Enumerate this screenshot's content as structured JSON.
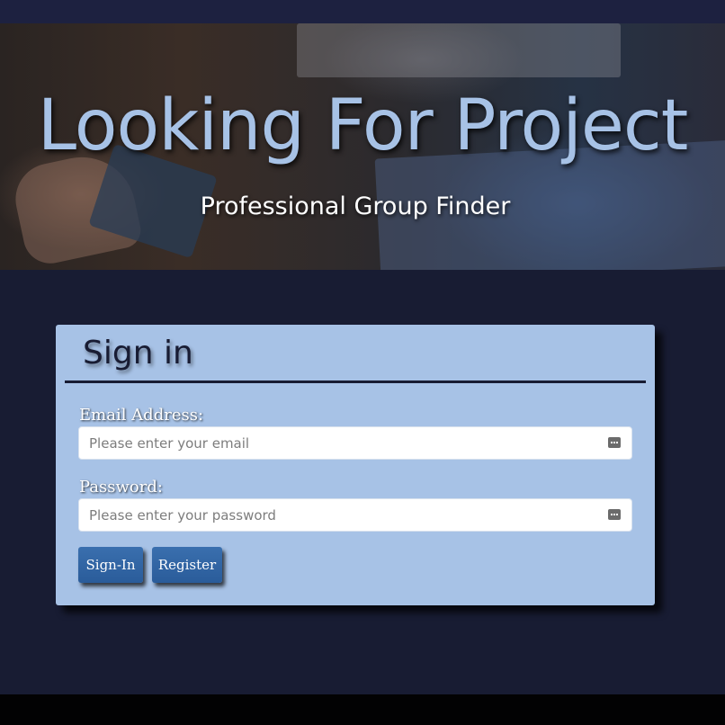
{
  "hero": {
    "title": "Looking For Project",
    "subtitle": "Professional Group Finder"
  },
  "signin": {
    "heading": "Sign in",
    "email": {
      "label": "Email Address:",
      "placeholder": "Please enter your email",
      "value": "",
      "icon": "autofill-icon"
    },
    "password": {
      "label": "Password:",
      "placeholder": "Please enter your password",
      "value": "",
      "icon": "autofill-icon"
    },
    "buttons": {
      "signin_label": "Sign-In",
      "register_label": "Register"
    }
  },
  "colors": {
    "background": "#181c33",
    "accent": "#a7c2e6",
    "button": "#2a5c9a",
    "footer": "#020203"
  }
}
